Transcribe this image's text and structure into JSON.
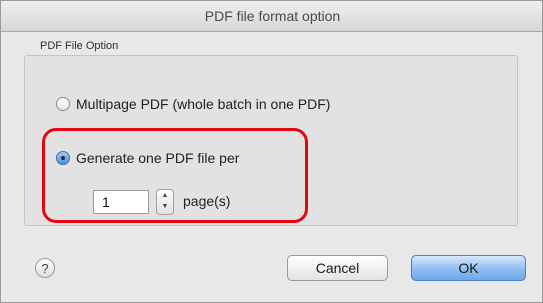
{
  "window": {
    "title": "PDF file format option"
  },
  "pdf_file_option": {
    "group_label": "PDF File Option",
    "options": [
      {
        "label": "Multipage PDF (whole batch in one PDF)",
        "selected": false
      },
      {
        "label": "Generate one PDF file per",
        "selected": true
      }
    ],
    "pages_value": "1",
    "pages_unit_label": "page(s)",
    "stepper_up_glyph": "▲",
    "stepper_down_glyph": "▼",
    "highlight_color": "#e30613"
  },
  "footer": {
    "help_label": "?",
    "cancel_label": "Cancel",
    "ok_label": "OK"
  }
}
